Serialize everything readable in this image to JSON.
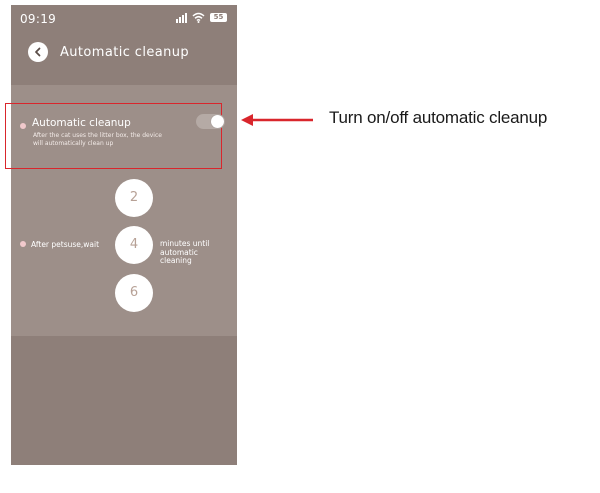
{
  "status_bar": {
    "time": "09:19",
    "battery": "55",
    "icons": [
      "signal-icon",
      "wifi-icon",
      "battery-icon"
    ]
  },
  "header": {
    "title": "Automatic cleanup",
    "back_icon": "chevron-left-icon"
  },
  "auto_cleanup": {
    "title": "Automatic cleanup",
    "description": "After the cat uses the litter box, the device will automatically clean up",
    "enabled": true
  },
  "wait": {
    "prefix": "After petsuse,wait",
    "suffix": "minutes until automatic cleaning",
    "options": [
      "2",
      "4",
      "6"
    ],
    "selected": "4"
  },
  "callout": {
    "text": "Turn on/off automatic cleanup"
  },
  "colors": {
    "background": "#8e7f79",
    "panel": "#9d8f89",
    "highlight_border": "#d9262c",
    "bullet": "#f1c9cc"
  }
}
